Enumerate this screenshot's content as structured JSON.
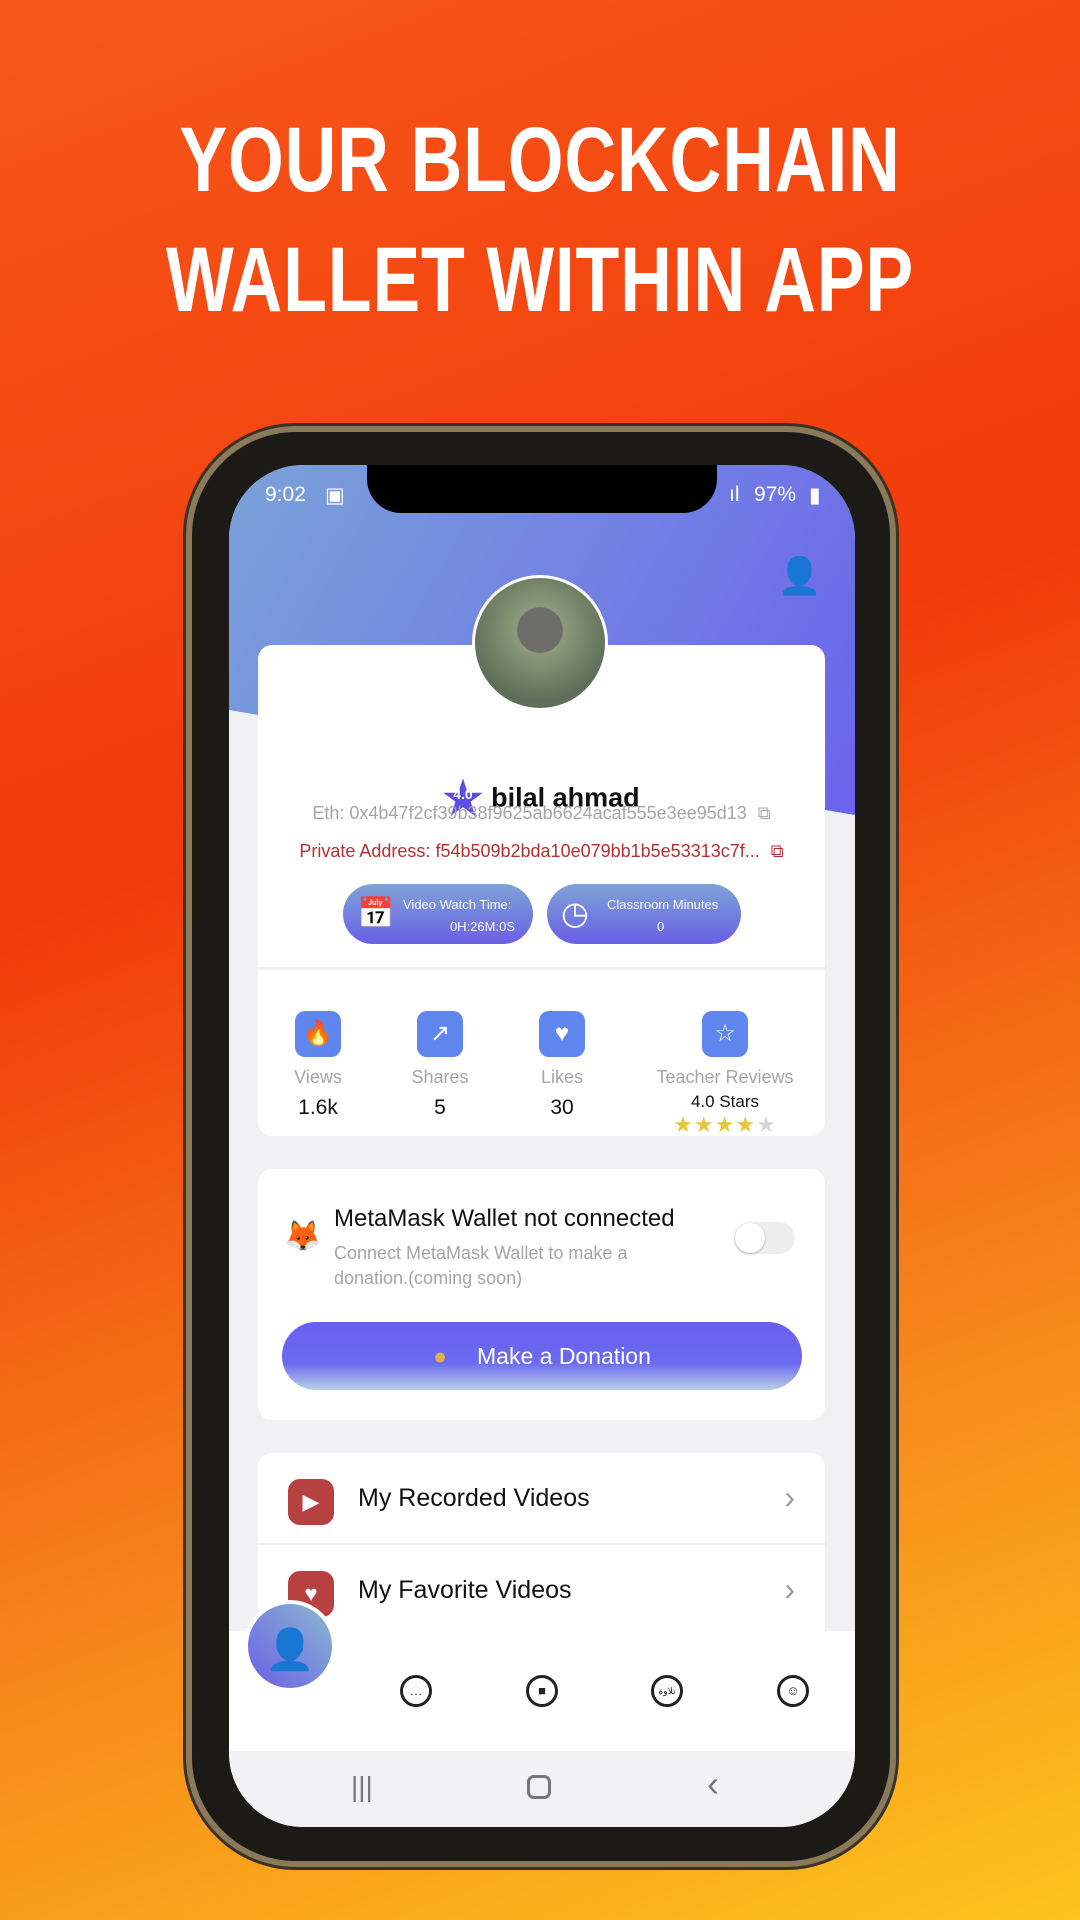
{
  "headline": [
    "YOUR BLOCKCHAIN",
    "WALLET WITHIN APP"
  ],
  "status_bar": {
    "time": "9:02",
    "battery": "97%"
  },
  "profile": {
    "name": "bilal ahmad",
    "rating_badge": "4.0",
    "eth_label": "Eth:",
    "eth_address": "0x4b47f2cf39b38f9625ab6624acaf555e3ee95d13",
    "private_label": "Private Address:",
    "private_address": "f54b509b2bda10e079bb1b5e53313c7f...",
    "watch_time": {
      "label": "Video Watch Time:",
      "value": "0H:26M:0S"
    },
    "classroom": {
      "label": "Classroom Minutes",
      "value": "0"
    }
  },
  "stats": [
    {
      "label": "Views",
      "value": "1.6k",
      "icon": "flame-icon"
    },
    {
      "label": "Shares",
      "value": "5",
      "icon": "share-icon"
    },
    {
      "label": "Likes",
      "value": "30",
      "icon": "heart-icon"
    },
    {
      "label": "Teacher Reviews",
      "value": "4.0 Stars",
      "icon": "review-icon",
      "stars": 4,
      "max_stars": 5
    }
  ],
  "wallet": {
    "title": "MetaMask Wallet not connected",
    "subtitle": "Connect MetaMask Wallet to make a donation.(coming soon)",
    "connected": false,
    "donate_label": "Make a Donation"
  },
  "menu": [
    {
      "label": "My Recorded Videos"
    },
    {
      "label": "My Favorite Videos"
    }
  ],
  "bottom_nav": [
    {
      "icon": "chat-icon"
    },
    {
      "icon": "video-icon"
    },
    {
      "icon": "tilawa-icon",
      "text": "تلاوة"
    },
    {
      "icon": "teacher-icon"
    }
  ],
  "colors": {
    "accent": "#6a5fe6",
    "private": "#b53030",
    "background": "#f5501a"
  }
}
